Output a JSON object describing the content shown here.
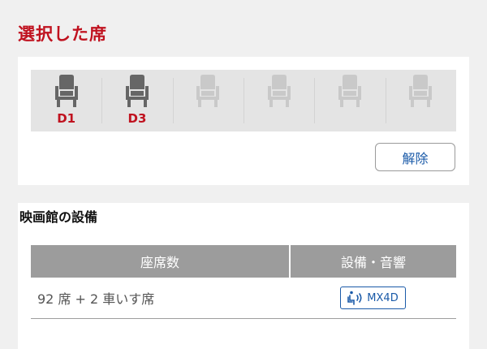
{
  "selected": {
    "title": "選択した席",
    "seats": [
      {
        "label": "D1",
        "state": "selected"
      },
      {
        "label": "D3",
        "state": "selected"
      },
      {
        "label": "",
        "state": "empty"
      },
      {
        "label": "",
        "state": "empty"
      },
      {
        "label": "",
        "state": "empty"
      },
      {
        "label": "",
        "state": "empty"
      }
    ],
    "release_label": "解除"
  },
  "facility": {
    "title": "映画館の設備",
    "headers": {
      "seats": "座席数",
      "equipment": "設備・音響"
    },
    "seat_count": "92 席 + 2 車いす席",
    "equipment_badge": {
      "label": "MX4D",
      "icon": "mx4d-motion-seat-icon"
    }
  },
  "colors": {
    "accent_red": "#c0121f",
    "link_blue": "#1a5aa8",
    "seat_selected": "#666666",
    "seat_empty": "#c9c9c9",
    "table_header_bg": "#9c9c9c"
  }
}
